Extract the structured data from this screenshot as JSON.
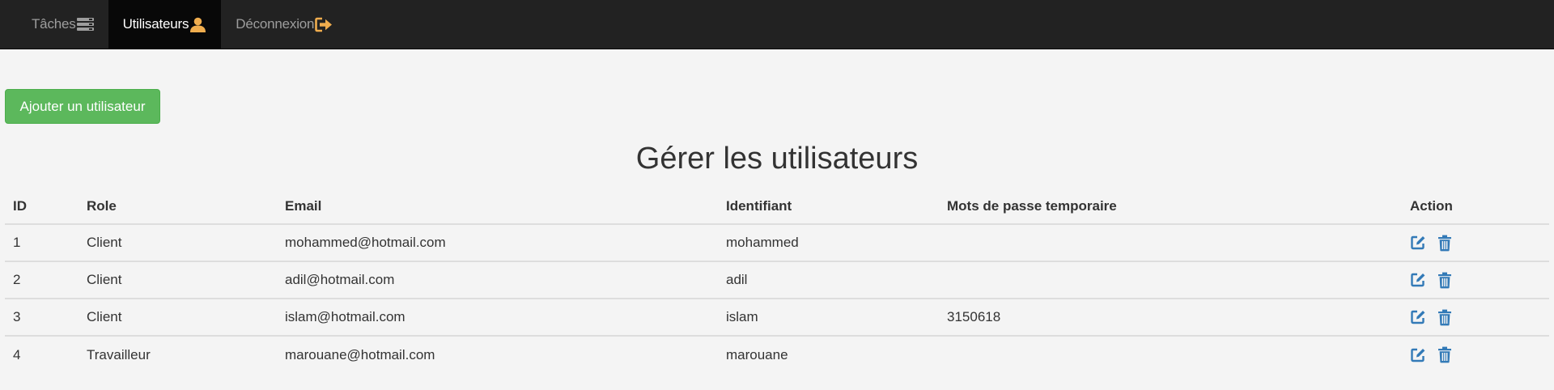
{
  "nav": {
    "items": [
      {
        "label": "Tâches",
        "icon": "tasks-icon",
        "active": false
      },
      {
        "label": "Utilisateurs",
        "icon": "user-icon",
        "active": true
      },
      {
        "label": "Déconnexion",
        "icon": "logout-icon",
        "active": false
      }
    ],
    "icon_color": "#f0ad4e"
  },
  "add_button_label": "Ajouter un utilisateur",
  "page_title": "Gérer les utilisateurs",
  "table": {
    "headers": [
      "ID",
      "Role",
      "Email",
      "Identifiant",
      "Mots de passe temporaire",
      "Action"
    ],
    "rows": [
      {
        "id": "1",
        "role": "Client",
        "email": "mohammed@hotmail.com",
        "identifiant": "mohammed",
        "temp_password": ""
      },
      {
        "id": "2",
        "role": "Client",
        "email": "adil@hotmail.com",
        "identifiant": "adil",
        "temp_password": ""
      },
      {
        "id": "3",
        "role": "Client",
        "email": "islam@hotmail.com",
        "identifiant": "islam",
        "temp_password": "3150618"
      },
      {
        "id": "4",
        "role": "Travailleur",
        "email": "marouane@hotmail.com",
        "identifiant": "marouane",
        "temp_password": ""
      }
    ],
    "action_icons": [
      "edit-icon",
      "trash-icon"
    ],
    "action_color": "#337ab7"
  }
}
